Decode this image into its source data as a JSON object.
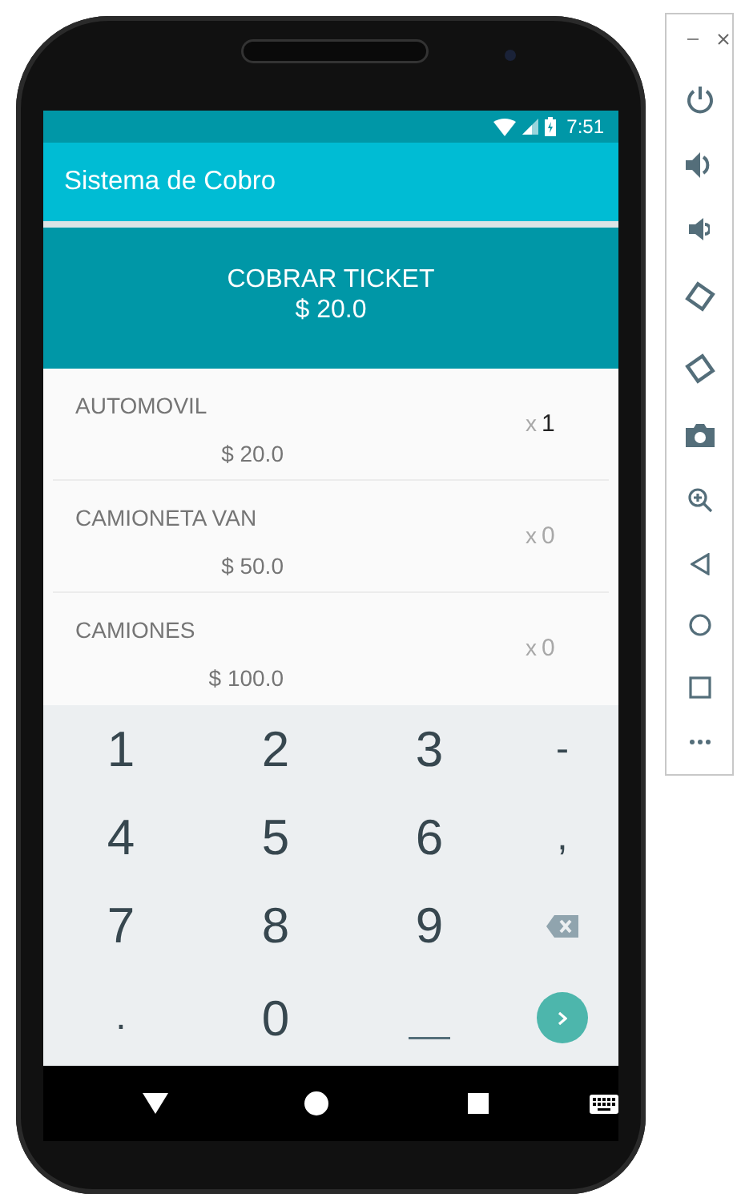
{
  "status_bar": {
    "time": "7:51"
  },
  "app_bar": {
    "title": "Sistema de Cobro"
  },
  "charge_button": {
    "label": "COBRAR TICKET",
    "amount": "$ 20.0"
  },
  "items": [
    {
      "name": "AUTOMOVIL",
      "price": "$ 20.0",
      "multiplier": "x",
      "quantity": "1"
    },
    {
      "name": "CAMIONETA VAN",
      "price": "$ 50.0",
      "multiplier": "x",
      "placeholder": "0"
    },
    {
      "name": "CAMIONES",
      "price": "$ 100.0",
      "multiplier": "x",
      "placeholder": "0"
    }
  ],
  "keyboard": [
    {
      "kind": "char",
      "label": "1"
    },
    {
      "kind": "char",
      "label": "2"
    },
    {
      "kind": "char",
      "label": "3"
    },
    {
      "kind": "symbol",
      "label": "-"
    },
    {
      "kind": "char",
      "label": "4"
    },
    {
      "kind": "char",
      "label": "5"
    },
    {
      "kind": "char",
      "label": "6"
    },
    {
      "kind": "symbol",
      "label": ","
    },
    {
      "kind": "char",
      "label": "7"
    },
    {
      "kind": "char",
      "label": "8"
    },
    {
      "kind": "char",
      "label": "9"
    },
    {
      "kind": "backspace"
    },
    {
      "kind": "symbol",
      "label": "."
    },
    {
      "kind": "char",
      "label": "0"
    },
    {
      "kind": "space"
    },
    {
      "kind": "enter"
    }
  ]
}
